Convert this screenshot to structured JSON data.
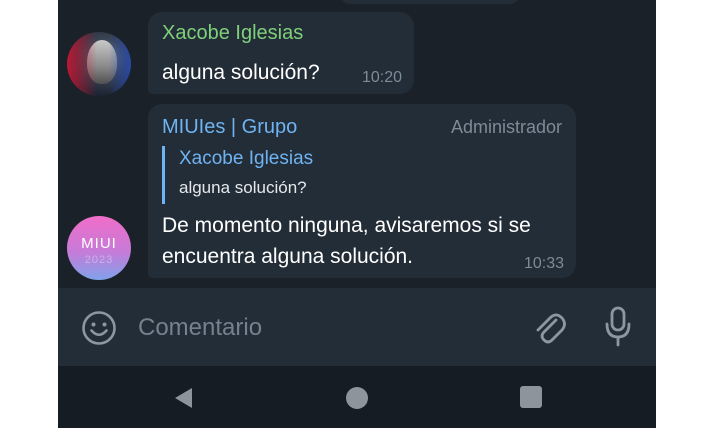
{
  "messages": [
    {
      "sender": "Xacobe Iglesias",
      "text": "alguna solución?",
      "time": "10:20"
    },
    {
      "sender": "MIUIes | Grupo",
      "role": "Administrador",
      "reply": {
        "sender": "Xacobe Iglesias",
        "text": "alguna solución?"
      },
      "text": "De momento ninguna, avisaremos si se encuentra alguna solución.",
      "time": "10:33"
    }
  ],
  "avatar_miui": {
    "logo_text": "MIUI",
    "logo_sub": "2023"
  },
  "composer": {
    "placeholder": "Comentario",
    "icons": [
      "emoji-icon",
      "attach-icon",
      "mic-icon"
    ]
  },
  "navigation": {
    "icons": [
      "back-icon",
      "home-icon",
      "recents-icon"
    ]
  },
  "colors": {
    "background": "#1a2129",
    "bubble": "#232d37",
    "sender_green": "#7fd07a",
    "sender_blue": "#6fb3f2",
    "muted": "#7d8a97"
  }
}
